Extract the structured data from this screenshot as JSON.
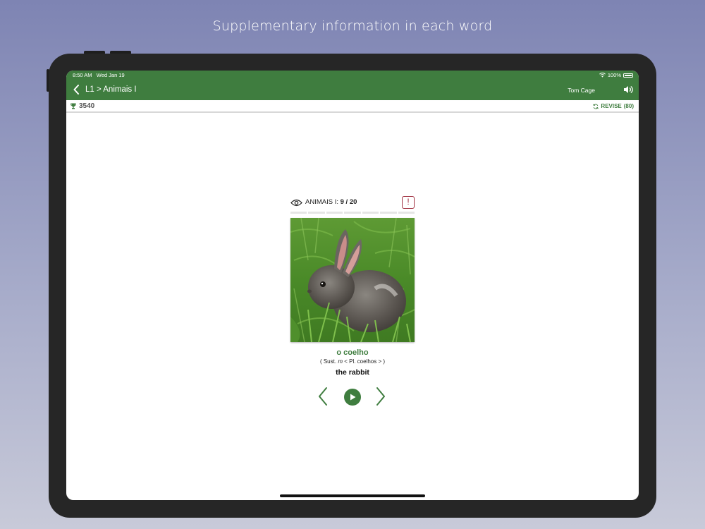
{
  "caption": "Supplementary information in each word",
  "status": {
    "time": "8:50 AM",
    "date": "Wed Jan 19",
    "battery": "100%"
  },
  "nav": {
    "title": "L1 > Animais I",
    "user": "Tom Cage"
  },
  "scorebar": {
    "score": "3540",
    "revise_label": "REVISE",
    "revise_count": "(80)"
  },
  "card": {
    "lesson_label": "ANIMAIS I:",
    "lesson_count": "9 / 20",
    "report_label": "!",
    "progress": 9,
    "progress_total": 20,
    "word": "o coelho",
    "grammar_open": "( Sust.",
    "grammar_gender": "m",
    "grammar_plural": "< Pl. coelhos > )",
    "translation": "the rabbit"
  },
  "colors": {
    "brand_green": "#3f7d3f",
    "report_red": "#a03040"
  },
  "icons": [
    "back-icon",
    "wifi-icon",
    "speaker-icon",
    "trophy-icon",
    "revise-icon",
    "eye-icon",
    "prev-icon",
    "play-icon",
    "next-icon"
  ]
}
